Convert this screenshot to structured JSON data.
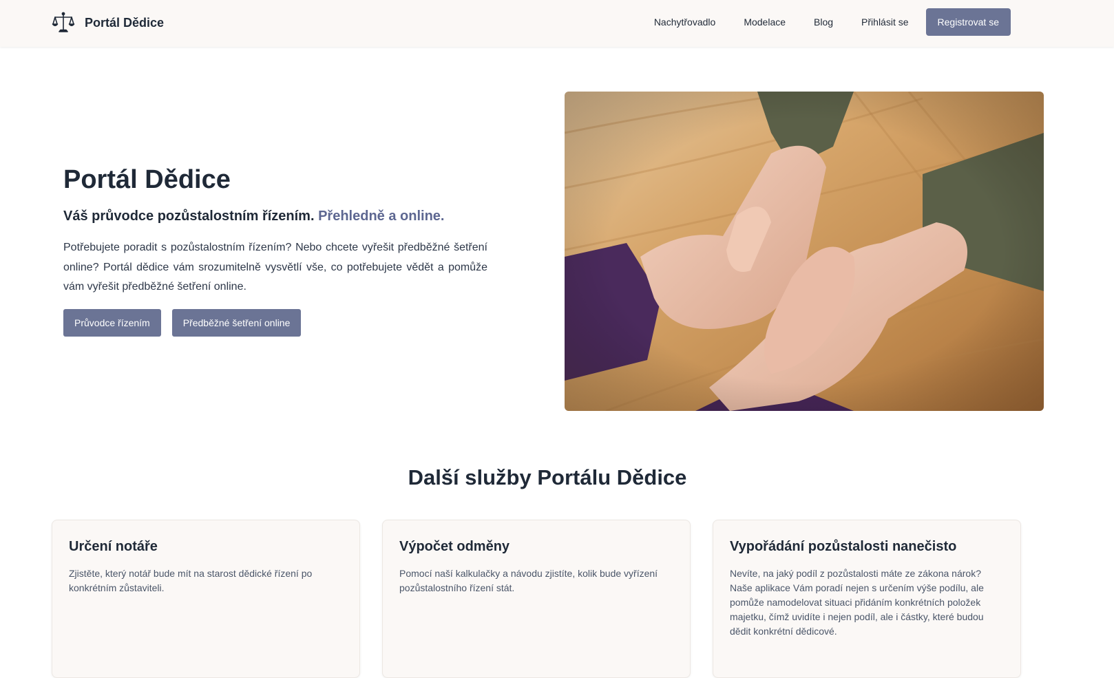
{
  "navbar": {
    "brand": "Portál Dědice",
    "logo_icon": "scales-of-justice-icon",
    "links": [
      "Nachytřovadlo",
      "Modelace",
      "Blog",
      "Přihlásit se"
    ],
    "cta": "Registrovat se"
  },
  "hero": {
    "title": "Portál Dědice",
    "subtitle": "Váš průvodce pozůstalostním řízením.",
    "subtitle_accent": "Přehledně a online.",
    "description": "Potřebujete poradit s pozůstalostním řízením? Nebo chcete vyřešit předběžné šetření online? Portál dědice vám srozumitelně vysvětlí vše, co potřebujete vědět a pomůže vám vyřešit předběžné šetření online.",
    "buttons": [
      "Průvodce řízením",
      "Předběžné šetření online"
    ],
    "image": "hands-holding-photo"
  },
  "services": {
    "title": "Další služby Portálu Dědice",
    "cards": [
      {
        "title": "Určení notáře",
        "text": "Zjistěte, který notář bude mít na starost dědické řízení po konkrétním zůstaviteli."
      },
      {
        "title": "Výpočet odměny",
        "text": "Pomocí naší kalkulačky a návodu zjistíte, kolik bude vyřízení pozůstalostního řízení stát."
      },
      {
        "title": "Vypořádání pozůstalosti nanečisto",
        "text": "Nevíte, na jaký podíl z pozůstalosti máte ze zákona nárok? Naše aplikace Vám poradí nejen s určením výše podílu, ale pomůže namodelovat situaci přidáním konkrétních položek majetku, čímž uvidíte i nejen podíl, ale i částky, které budou dědit konkrétní dědicové."
      }
    ]
  },
  "colors": {
    "primary": "#6b7495",
    "accent_text": "#5d6791",
    "navbar_bg": "#fbf8f6",
    "card_bg": "#fbf8f6",
    "heading": "#1f2937"
  }
}
